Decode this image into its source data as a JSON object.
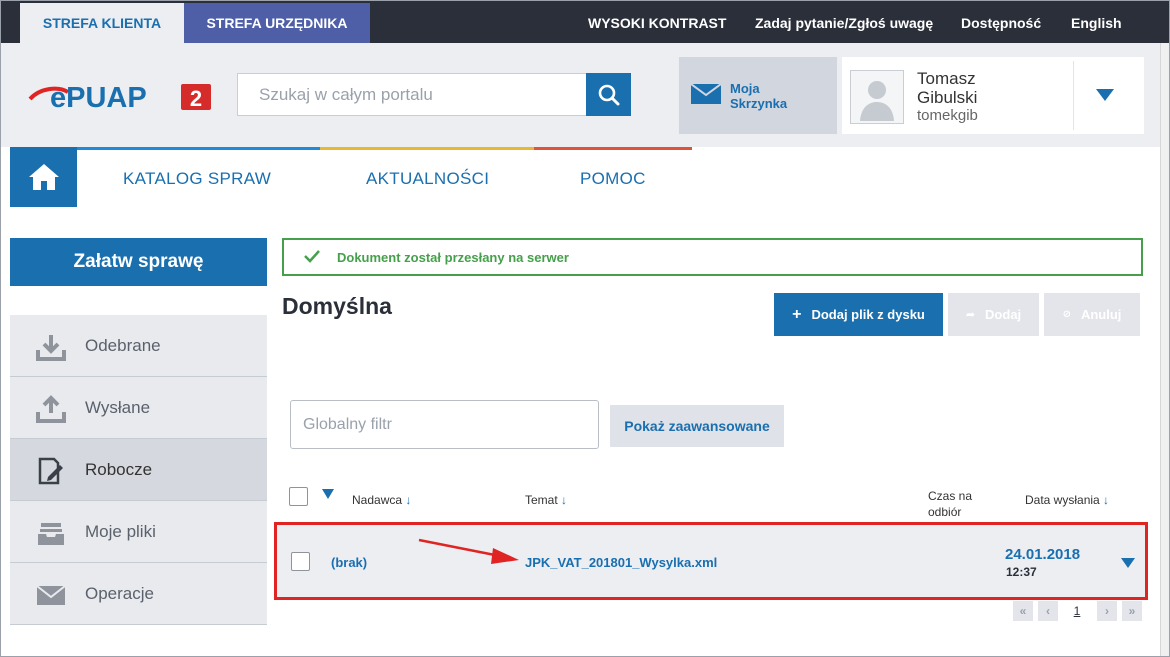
{
  "topbar": {
    "zone_client": "STREFA KLIENTA",
    "zone_official": "STREFA URZĘDNIKA",
    "high_contrast": "WYSOKI KONTRAST",
    "ask_question": "Zadaj pytanie/Zgłoś uwagę",
    "accessibility": "Dostępność",
    "language": "English"
  },
  "header": {
    "logo_text": "ePUAP",
    "logo_version": "2",
    "search_placeholder": "Szukaj w całym portalu",
    "mailbox_label": "Moja Skrzynka",
    "user_first_name": "Tomasz",
    "user_last_name": "Gibulski",
    "user_login": "tomekgib"
  },
  "nav": {
    "items": [
      "KATALOG SPRAW",
      "AKTUALNOŚCI",
      "POMOC"
    ],
    "stripe_colors": [
      "#1f8bd8",
      "#e8b830",
      "#e0533a"
    ]
  },
  "sidebar": {
    "settle_button": "Załatw sprawę",
    "items": [
      {
        "label": "Odebrane",
        "icon": "download-icon"
      },
      {
        "label": "Wysłane",
        "icon": "upload-icon"
      },
      {
        "label": "Robocze",
        "icon": "draft-edit-icon",
        "active": true
      },
      {
        "label": "Moje pliki",
        "icon": "inbox-tray-icon"
      },
      {
        "label": "Operacje",
        "icon": "envelope-icon"
      }
    ]
  },
  "alert": {
    "message": "Dokument został przesłany na serwer"
  },
  "main": {
    "title": "Domyślna",
    "add_file_button": "Dodaj plik z dysku",
    "add_button": "Dodaj",
    "cancel_button": "Anuluj",
    "filter_placeholder": "Globalny filtr",
    "advanced_button": "Pokaż zaawansowane"
  },
  "table": {
    "columns": {
      "sender": "Nadawca",
      "subject": "Temat",
      "receive_time": "Czas na odbiór",
      "sent_date": "Data wysłania"
    },
    "rows": [
      {
        "sender": "(brak)",
        "subject": "JPK_VAT_201801_Wysylka.xml",
        "date": "24.01.2018",
        "time": "12:37"
      }
    ]
  },
  "pager": {
    "first": "«",
    "prev": "‹",
    "current": "1",
    "next": "›",
    "last": "»"
  },
  "colors": {
    "primary": "#1a6faf",
    "topbar": "#2b2f3a",
    "success": "#46a04b",
    "highlight": "#e02424"
  }
}
